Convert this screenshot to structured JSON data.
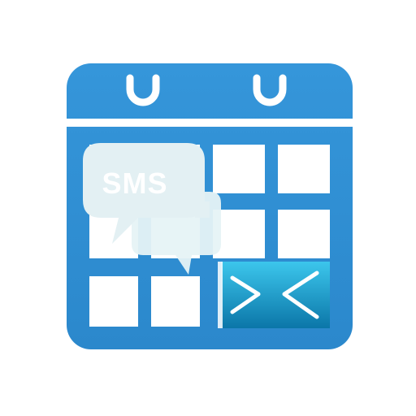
{
  "icon": {
    "name": "sms-scheduler-app-icon",
    "bubble_text": "SMS",
    "icons": [
      "calendar-icon",
      "chat-bubble-icon",
      "envelope-icon"
    ],
    "colors": {
      "calendar_blue": "#2f8fd3",
      "calendar_edge": "#1f7fc3",
      "grid_white": "#ffffff",
      "bubble_fill": "#e4f1f4",
      "bubble_text": "#ffffff",
      "envelope_top": "#35c0e8",
      "envelope_bottom": "#0e7fb0",
      "envelope_lines": "#ffffff"
    }
  }
}
